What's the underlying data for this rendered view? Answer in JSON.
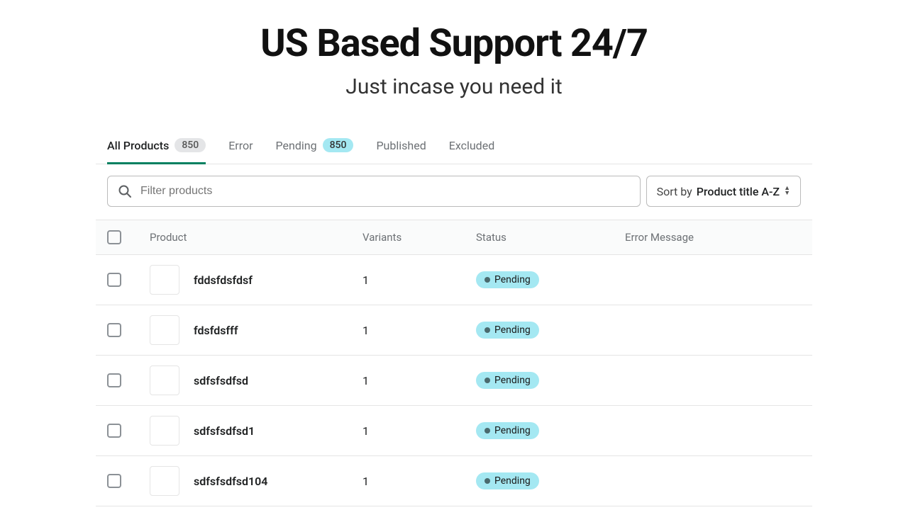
{
  "header": {
    "title": "US Based Support 24/7",
    "subtitle": "Just incase you need it"
  },
  "tabs": [
    {
      "label": "All Products",
      "badge": "850",
      "badgeStyle": "gray",
      "active": true
    },
    {
      "label": "Error"
    },
    {
      "label": "Pending",
      "badge": "850",
      "badgeStyle": "teal"
    },
    {
      "label": "Published"
    },
    {
      "label": "Excluded"
    }
  ],
  "search": {
    "placeholder": "Filter products"
  },
  "sort": {
    "label": "Sort by",
    "value": "Product title A-Z"
  },
  "columns": {
    "product": "Product",
    "variants": "Variants",
    "status": "Status",
    "error": "Error Message"
  },
  "rows": [
    {
      "name": "fddsfdsfdsf",
      "variants": "1",
      "status": "Pending"
    },
    {
      "name": "fdsfdsfff",
      "variants": "1",
      "status": "Pending"
    },
    {
      "name": "sdfsfsdfsd",
      "variants": "1",
      "status": "Pending"
    },
    {
      "name": "sdfsfsdfsd1",
      "variants": "1",
      "status": "Pending"
    },
    {
      "name": "sdfsfsdfsd104",
      "variants": "1",
      "status": "Pending"
    }
  ]
}
